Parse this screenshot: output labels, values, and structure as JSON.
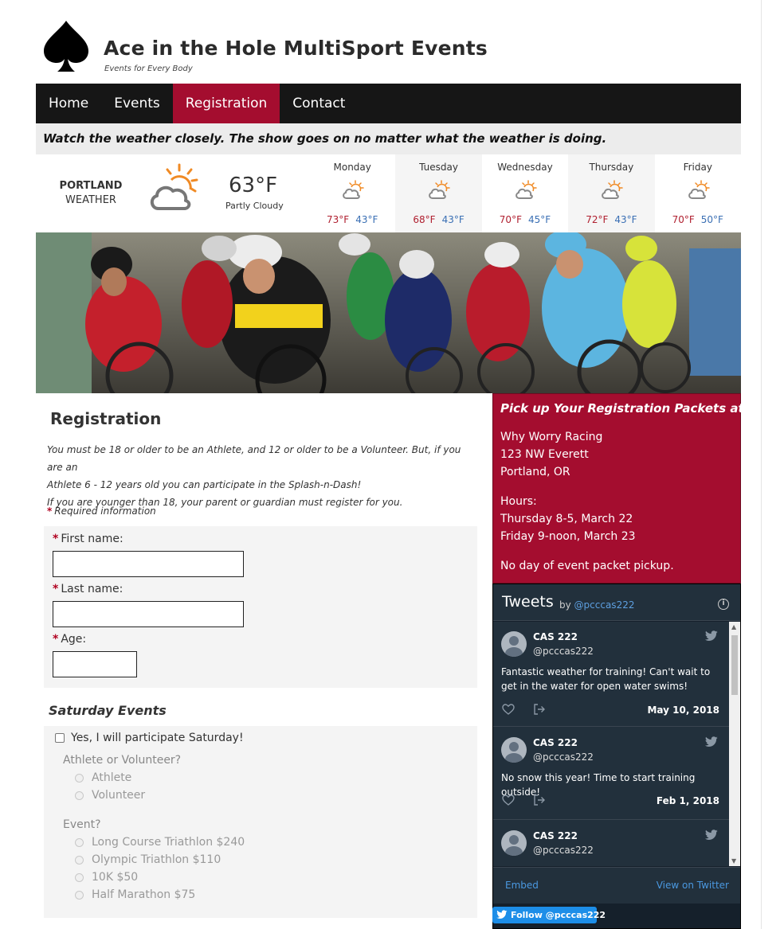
{
  "site": {
    "title": "Ace in the Hole MultiSport Events",
    "tagline": "Events for Every Body"
  },
  "nav": {
    "items": [
      {
        "label": "Home",
        "active": false
      },
      {
        "label": "Events",
        "active": false
      },
      {
        "label": "Registration",
        "active": true
      },
      {
        "label": "Contact",
        "active": false
      }
    ]
  },
  "notice": "Watch the weather closely. The show goes on no matter what the weather is doing.",
  "weather": {
    "city": "PORTLAND",
    "label": "WEATHER",
    "current_temp": "63°F",
    "current_condition": "Partly Cloudy",
    "current_icon": "partly-cloudy-icon",
    "days": [
      {
        "name": "Monday",
        "high": "73°F",
        "low": "43°F"
      },
      {
        "name": "Tuesday",
        "high": "68°F",
        "low": "43°F"
      },
      {
        "name": "Wednesday",
        "high": "70°F",
        "low": "45°F"
      },
      {
        "name": "Thursday",
        "high": "72°F",
        "low": "43°F"
      },
      {
        "name": "Friday",
        "high": "70°F",
        "low": "50°F"
      }
    ]
  },
  "form": {
    "title": "Registration",
    "intro_line1": "You must be 18 or older to be an Athlete, and 12 or older to be a Volunteer. But, if you are an",
    "intro_line2": "Athlete 6 - 12 years old you can participate in the Splash-n-Dash!",
    "intro_line3": "If you are younger than 18, your parent or guardian must register for you.",
    "required_note": "Required information",
    "required_mark": "*",
    "first_name_label": "First name:",
    "first_name_value": "",
    "last_name_label": "Last name:",
    "last_name_value": "",
    "age_label": "Age:",
    "age_value": "",
    "saturday": {
      "title": "Saturday Events",
      "checkbox_label": "Yes, I will participate Saturday!",
      "role_label": "Athlete or Volunteer?",
      "roles": [
        "Athlete",
        "Volunteer"
      ],
      "event_label": "Event?",
      "events": [
        "Long Course Triathlon $240",
        "Olympic Triathlon $110",
        "10K $50",
        "Half Marathon $75"
      ]
    }
  },
  "packet": {
    "title": "Pick up Your Registration Packets at:",
    "store": "Why Worry Racing",
    "address1": "123 NW Everett",
    "address2": "Portland, OR",
    "hours_label": "Hours:",
    "hours1": "Thursday 8-5, March 22",
    "hours2": "Friday 9-noon, March 23",
    "note": "No day of event packet pickup."
  },
  "twitter": {
    "title": "Tweets",
    "by": "by",
    "handle": "@pcccas222",
    "tweets": [
      {
        "name": "CAS 222",
        "handle": "@pcccas222",
        "text": "Fantastic weather for training! Can't wait to get in the water for open water swims!",
        "date": "May 10, 2018"
      },
      {
        "name": "CAS 222",
        "handle": "@pcccas222",
        "text": "No snow this year! Time to start training outside!",
        "date": "Feb 1, 2018"
      },
      {
        "name": "CAS 222",
        "handle": "@pcccas222",
        "text": "",
        "date": ""
      }
    ],
    "embed_label": "Embed",
    "view_label": "View on Twitter",
    "follow_label": "Follow @pcccas222"
  },
  "colors": {
    "accent": "#a40d2f",
    "nav_bg": "#161616",
    "twitter_bg": "#22303c",
    "twitter_link": "#4a98e0",
    "high_temp": "#b02030",
    "low_temp": "#3a6fb4"
  }
}
